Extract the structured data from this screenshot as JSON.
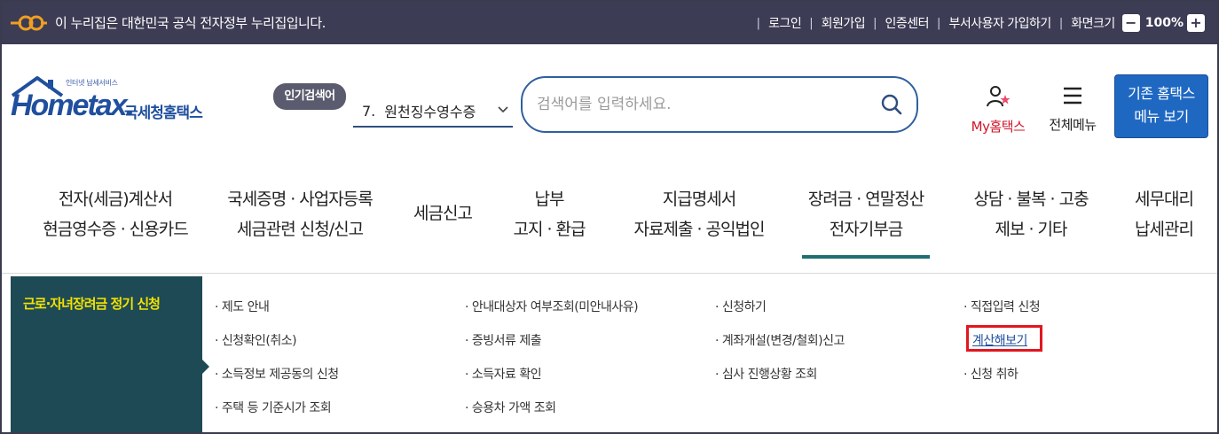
{
  "topbar": {
    "notice": "이 누리집은 대한민국 공식 전자정부 누리집입니다.",
    "links": [
      "로그인",
      "회원가입",
      "인증센터",
      "부서사용자 가입하기",
      "화면크기"
    ],
    "zoom_minus": "−",
    "zoom_value": "100%",
    "zoom_plus": "+"
  },
  "header": {
    "logo_small": "인터넷 납세서비스",
    "logo_main": "Hometax.",
    "logo_kr": "국세청홈택스",
    "popular_badge": "인기검색어",
    "popular_num": "7.",
    "popular_text": "원천징수영수증",
    "search_placeholder": "검색어를 입력하세요.",
    "my_label": "My홈택스",
    "menu_label": "전체메뉴",
    "old_line1": "기존 홈택스",
    "old_line2": "메뉴 보기"
  },
  "nav": [
    {
      "line1": "전자(세금)계산서",
      "line2": "현금영수증 · 신용카드"
    },
    {
      "line1": "국세증명 · 사업자등록",
      "line2": "세금관련 신청/신고"
    },
    {
      "line1": "세금신고",
      "line2": ""
    },
    {
      "line1": "납부",
      "line2": "고지 · 환급"
    },
    {
      "line1": "지급명세서",
      "line2": "자료제출 · 공익법인"
    },
    {
      "line1": "장려금 · 연말정산",
      "line2": "전자기부금"
    },
    {
      "line1": "상담 · 불복 · 고충",
      "line2": "제보 · 기타"
    },
    {
      "line1": "세무대리",
      "line2": "납세관리"
    }
  ],
  "submenu": {
    "title": "근로·자녀장려금 정기 신청",
    "col1": [
      "· 제도 안내",
      "· 신청확인(취소)",
      "· 소득정보 제공동의 신청",
      "· 주택 등 기준시가 조회"
    ],
    "col2": [
      "· 안내대상자 여부조회(미안내사유)",
      "· 증빙서류 제출",
      "· 소득자료 확인",
      "· 승용차 가액 조회"
    ],
    "col3": [
      "· 신청하기",
      "· 계좌개설(변경/철회)신고",
      "· 심사 진행상황 조회"
    ],
    "col4": [
      "· 직접입력 신청",
      "계산해보기",
      "· 신청 취하"
    ]
  },
  "colors": {
    "topbar": "#3d3c55",
    "submenu_bg": "#1e4a55",
    "submenu_title": "#f2e200",
    "active_underline": "#1f6e73",
    "highlight": "#e2161f",
    "old_button": "#1f68c2"
  }
}
